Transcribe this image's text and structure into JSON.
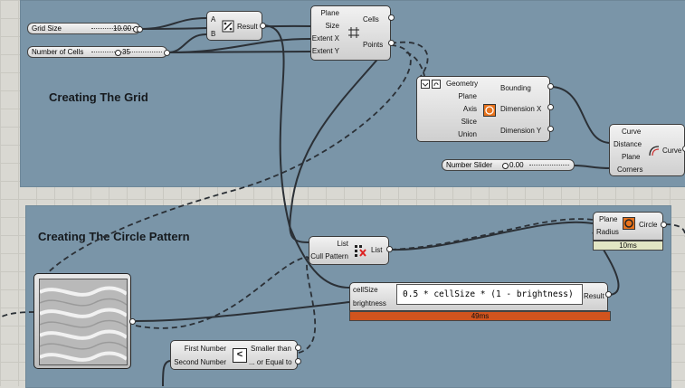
{
  "groups": {
    "grid_title": "Creating The Grid",
    "circle_title": "Creating The Circle Pattern"
  },
  "sliders": {
    "grid_size": {
      "label": "Grid Size",
      "value": "10.00"
    },
    "number_of_cells": {
      "label": "Number of Cells",
      "value": "35"
    },
    "number_slider": {
      "label": "Number Slider",
      "value": "0.00"
    }
  },
  "division": {
    "inputs": [
      "A",
      "B"
    ],
    "output": "Result"
  },
  "square_grid": {
    "inputs": [
      "Plane",
      "Size",
      "Extent X",
      "Extent Y"
    ],
    "outputs": [
      "Cells",
      "Points"
    ]
  },
  "bounding_box": {
    "inputs": [
      "Geometry",
      "Plane",
      "Axis",
      "Slice",
      "Union"
    ],
    "outputs": [
      "Bounding",
      "Dimension X",
      "Dimension Y"
    ]
  },
  "rectangle": {
    "inputs": [
      "Curve",
      "Distance",
      "Plane",
      "Corners"
    ],
    "output": "Curve"
  },
  "circle": {
    "inputs": [
      "Plane",
      "Radius"
    ],
    "output": "Circle",
    "timer": "10ms"
  },
  "cull_pattern": {
    "inputs": [
      "List",
      "Cull Pattern"
    ],
    "output": "List"
  },
  "expression": {
    "inputs": [
      "cellSize",
      "brightness"
    ],
    "expression": "0.5 * cellSize * (1 - brightness)",
    "output": "Result",
    "timer": "49ms"
  },
  "smaller_than": {
    "inputs": [
      "First Number",
      "Second Number"
    ],
    "outputs": [
      "Smaller than",
      "... or Equal to"
    ],
    "symbol": "<"
  },
  "colors": {
    "group_fill": "#7a95a8",
    "canvas": "#d9d8d2",
    "warning_bar": "#d2541e",
    "ok_bar": "#e2e6c4"
  }
}
